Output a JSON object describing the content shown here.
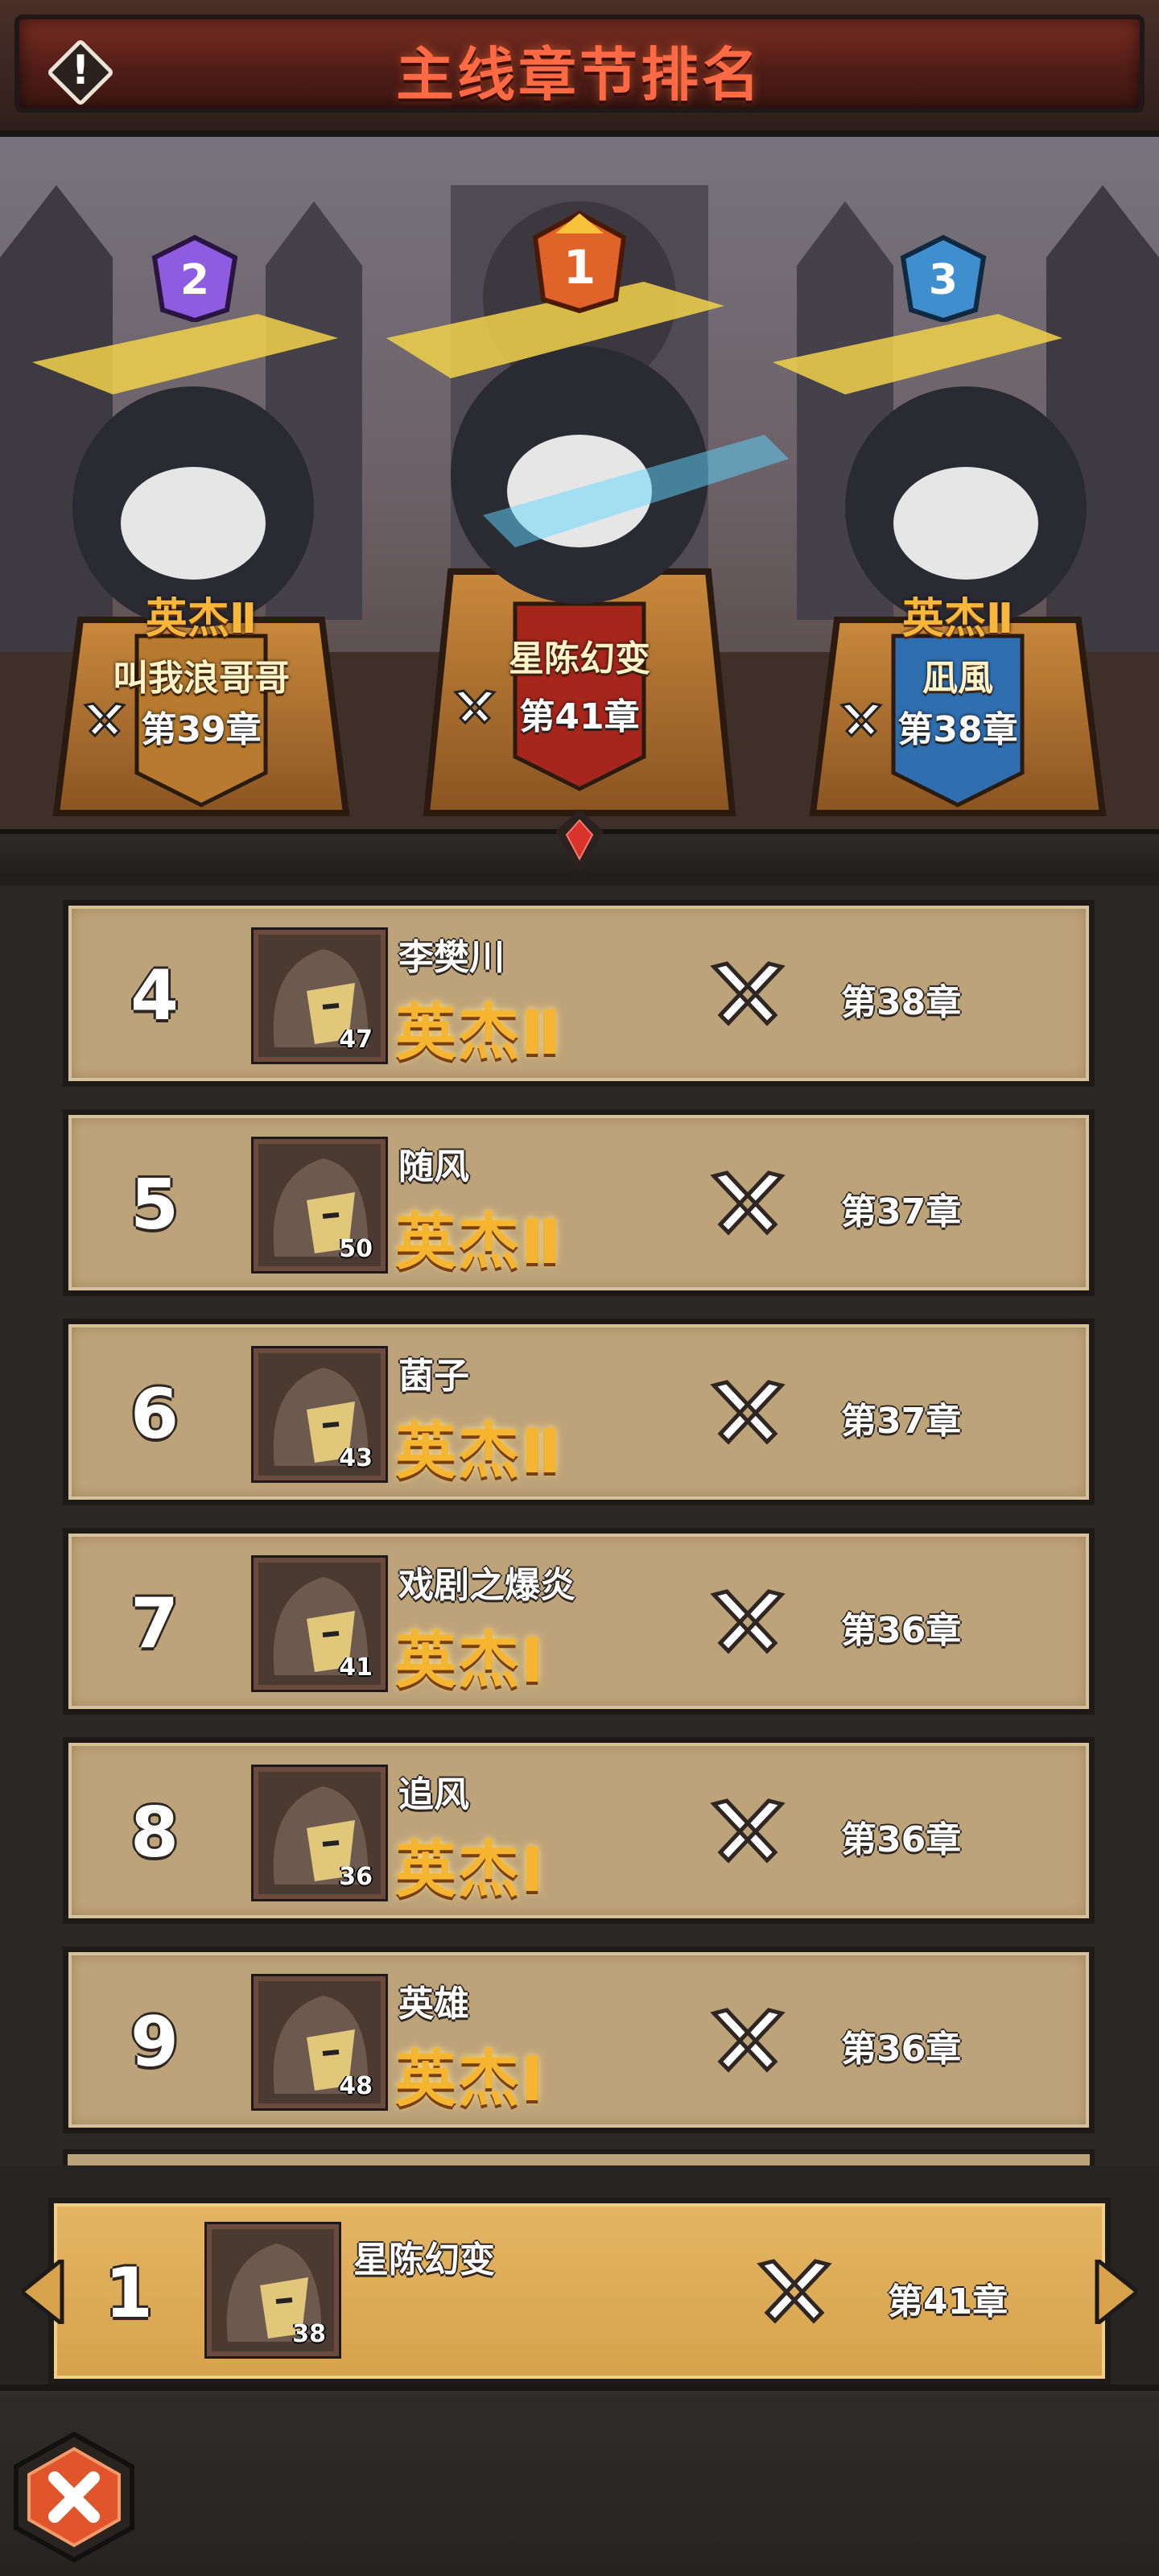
{
  "header": {
    "title": "主线章节排名",
    "info_icon": "exclamation-icon"
  },
  "podium": [
    {
      "rank": "2",
      "honor": "英杰Ⅱ",
      "name": "叫我浪哥哥",
      "chapter": "第39章",
      "badge_color": "#8d5ce0"
    },
    {
      "rank": "1",
      "honor": "",
      "name": "星陈幻变",
      "chapter": "第41章",
      "badge_color": "#e0642a"
    },
    {
      "rank": "3",
      "honor": "英杰Ⅱ",
      "name": "凪風",
      "chapter": "第38章",
      "badge_color": "#3f8fcf"
    }
  ],
  "rows": [
    {
      "rank": "4",
      "name": "李樊川",
      "level": "47",
      "honor": "英杰Ⅱ",
      "chapter": "第38章"
    },
    {
      "rank": "5",
      "name": "随风",
      "level": "50",
      "honor": "英杰Ⅱ",
      "chapter": "第37章"
    },
    {
      "rank": "6",
      "name": "菌子",
      "level": "43",
      "honor": "英杰Ⅱ",
      "chapter": "第37章"
    },
    {
      "rank": "7",
      "name": "戏剧之爆炎",
      "level": "41",
      "honor": "英杰Ⅰ",
      "chapter": "第36章"
    },
    {
      "rank": "8",
      "name": "追风",
      "level": "36",
      "honor": "英杰Ⅰ",
      "chapter": "第36章"
    },
    {
      "rank": "9",
      "name": "英雄",
      "level": "48",
      "honor": "英杰Ⅰ",
      "chapter": "第36章"
    }
  ],
  "my_rank": {
    "rank": "1",
    "name": "星陈幻变",
    "level": "38",
    "chapter": "第41章"
  },
  "footer": {
    "close_icon": "close-icon"
  },
  "colors": {
    "honor_gold": "#f5b531",
    "row_bg": "#bda379",
    "my_rank_bg": "#e3b664",
    "title_red": "#ff6a44"
  }
}
